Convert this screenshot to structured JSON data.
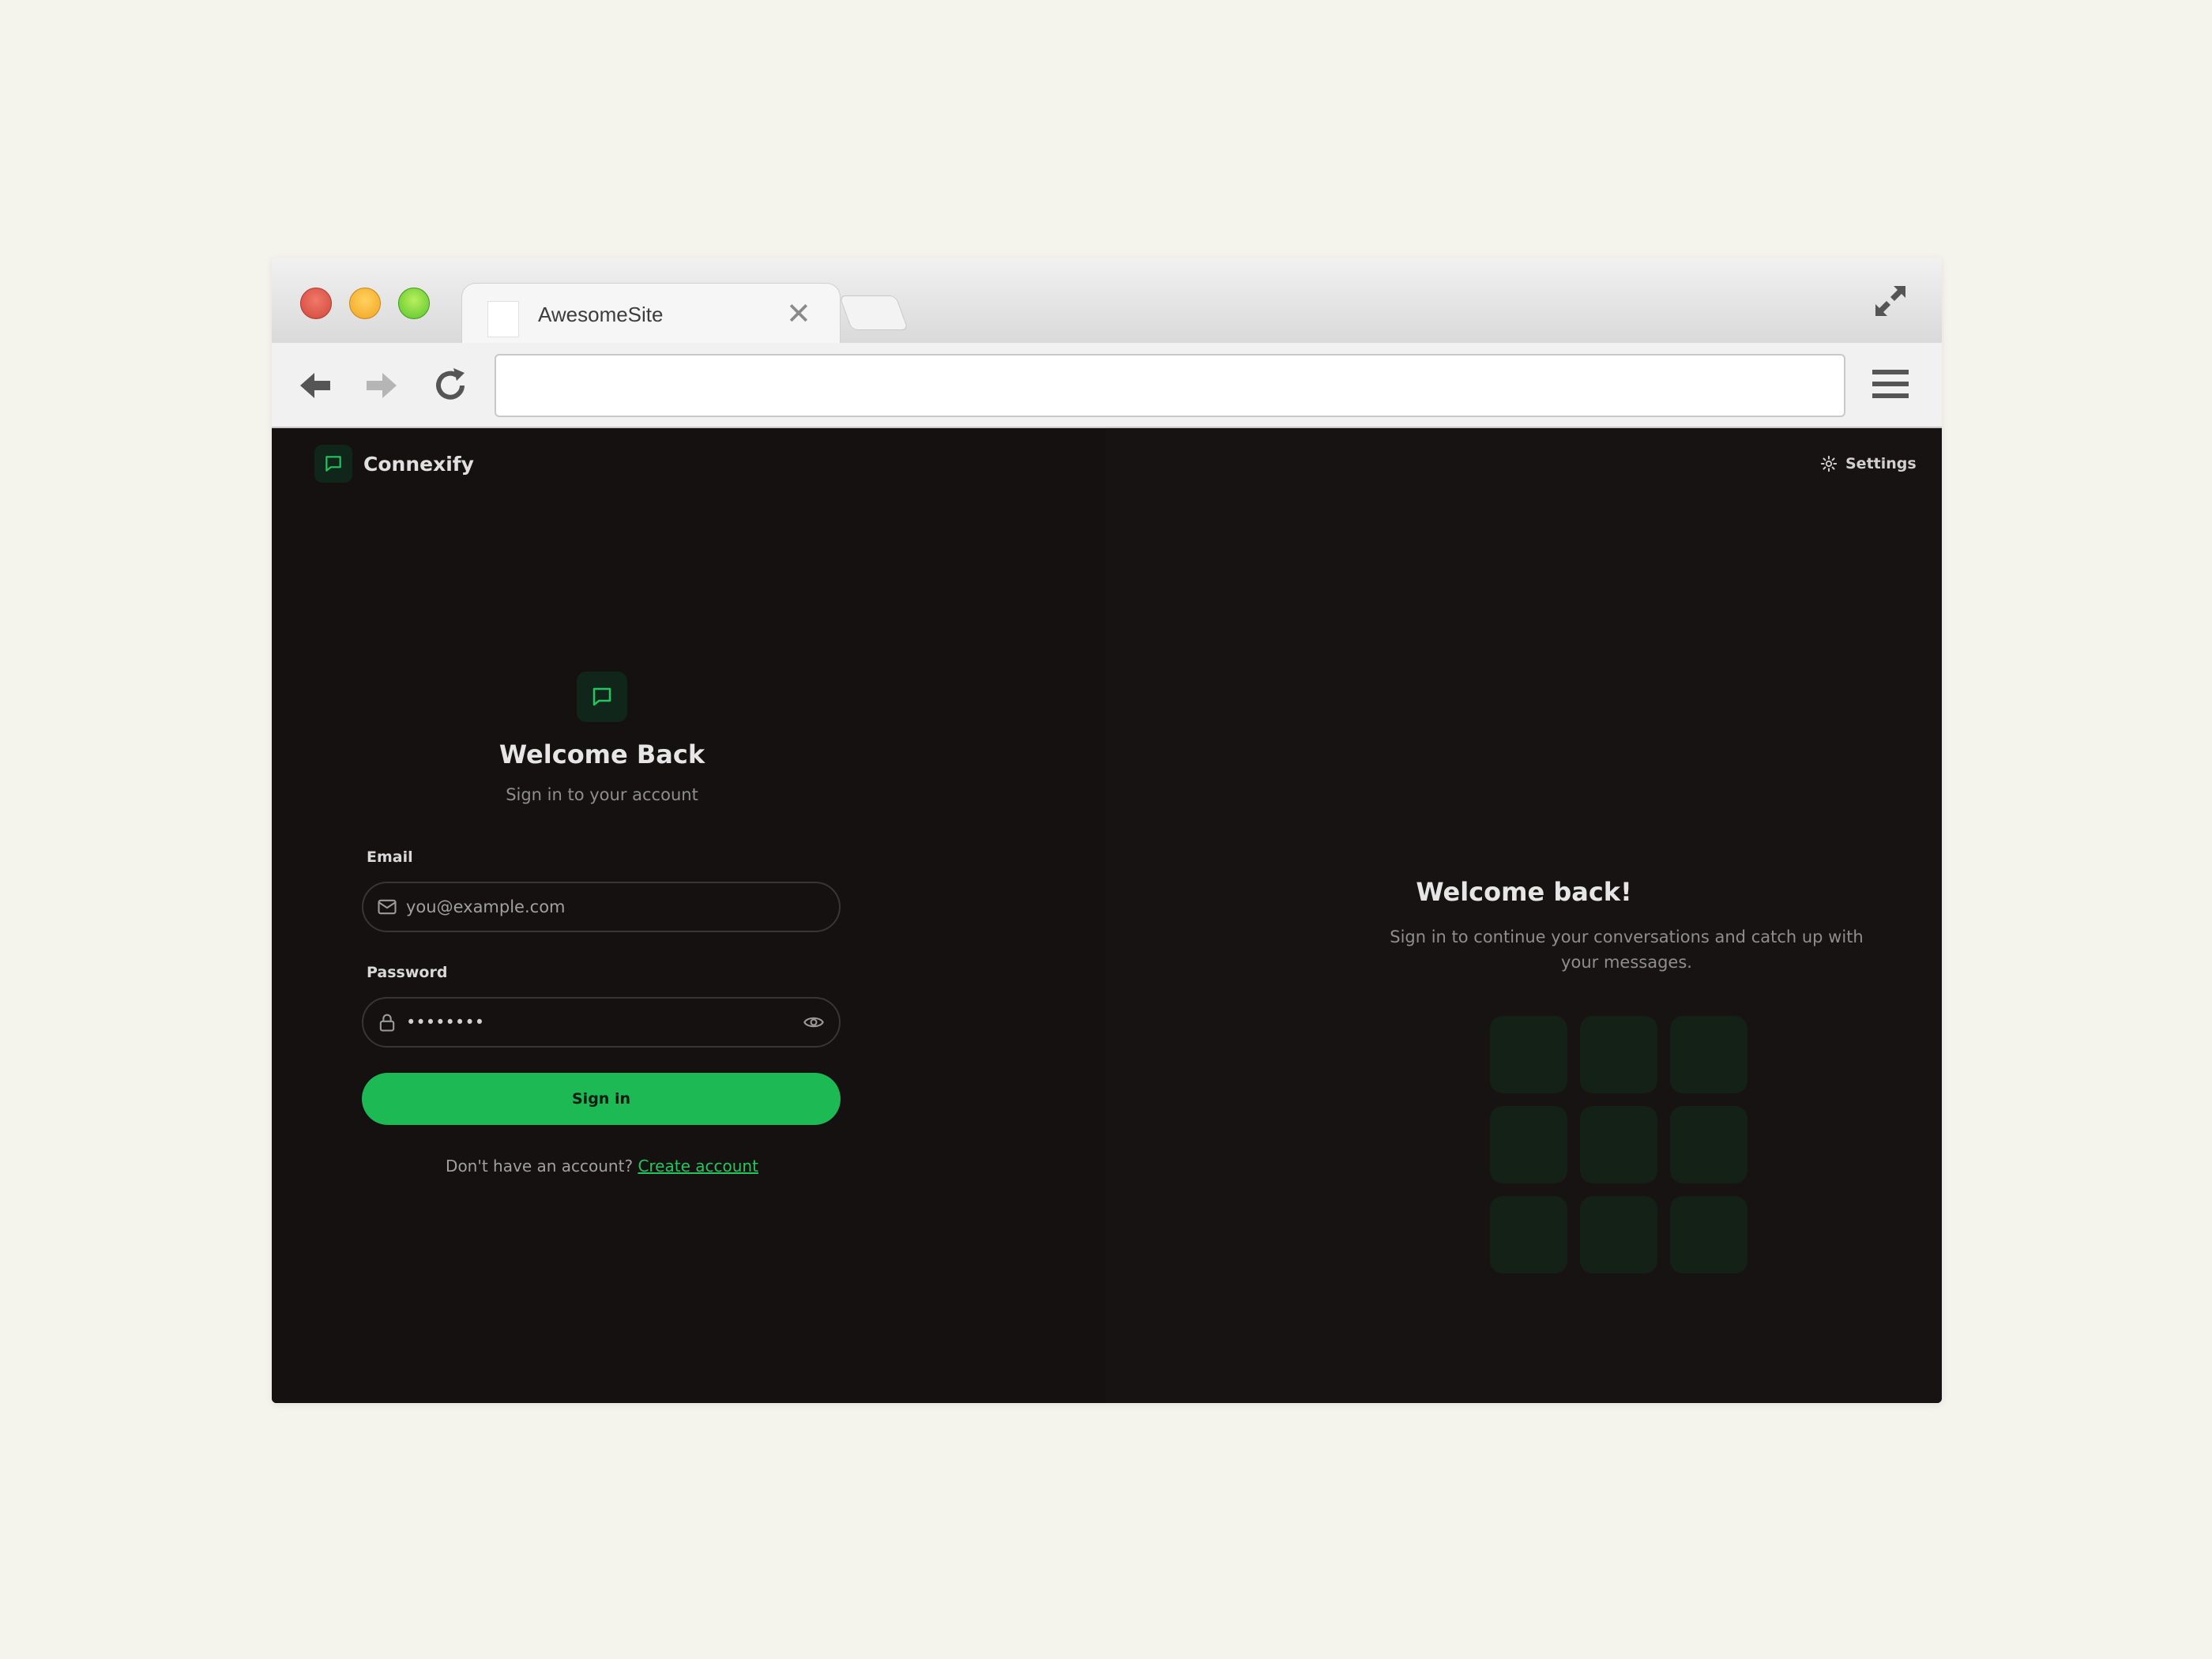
{
  "browser": {
    "tab_title": "AwesomeSite",
    "tab_close": "✕",
    "address_value": ""
  },
  "app": {
    "brand_name": "Connexify",
    "settings_label": "Settings",
    "accent_color": "#1db954"
  },
  "login": {
    "title": "Welcome Back",
    "subtitle": "Sign in to your account",
    "email_label": "Email",
    "email_placeholder": "you@example.com",
    "password_label": "Password",
    "password_value": "••••••••",
    "submit_label": "Sign in",
    "signup_prompt": "Don't have an account?",
    "signup_link": "Create account"
  },
  "promo": {
    "title": "Welcome back!",
    "subtitle": "Sign in to continue your conversations and catch up with your messages.",
    "tile_count": 9
  }
}
